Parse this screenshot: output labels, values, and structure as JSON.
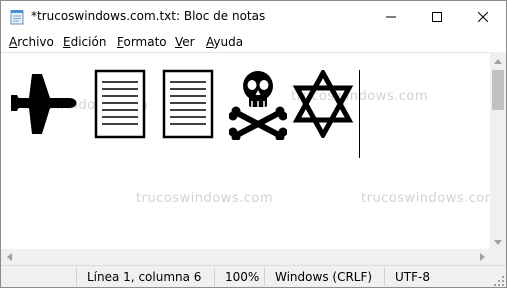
{
  "window": {
    "title": "*trucoswindows.com.txt: Bloc de notas",
    "icons": {
      "app": "notepad-icon",
      "minimize": "minimize-icon",
      "maximize": "maximize-icon",
      "close": "close-icon"
    }
  },
  "menu": {
    "items": [
      {
        "accel": "A",
        "rest": "rchivo"
      },
      {
        "accel": "E",
        "rest": "dición"
      },
      {
        "accel": "F",
        "rest": "ormato"
      },
      {
        "accel": "V",
        "rest": "er"
      },
      {
        "accel": "A",
        "rest": "yuda"
      }
    ]
  },
  "editor": {
    "glyphs": [
      "✈",
      "▤",
      "▤",
      "☠",
      "✡"
    ],
    "glyph_icons": [
      "airplane-icon",
      "document-icon",
      "document-icon",
      "skull-crossbones-icon",
      "star-of-david-icon"
    ]
  },
  "watermarks": [
    "trucoswindows.com",
    "trucoswindows.com",
    "trucoswindows.com",
    "trucoswindows.com"
  ],
  "status": {
    "position": "Línea 1, columna 6",
    "zoom": "100%",
    "line_endings": "Windows (CRLF)",
    "encoding": "UTF-8"
  }
}
